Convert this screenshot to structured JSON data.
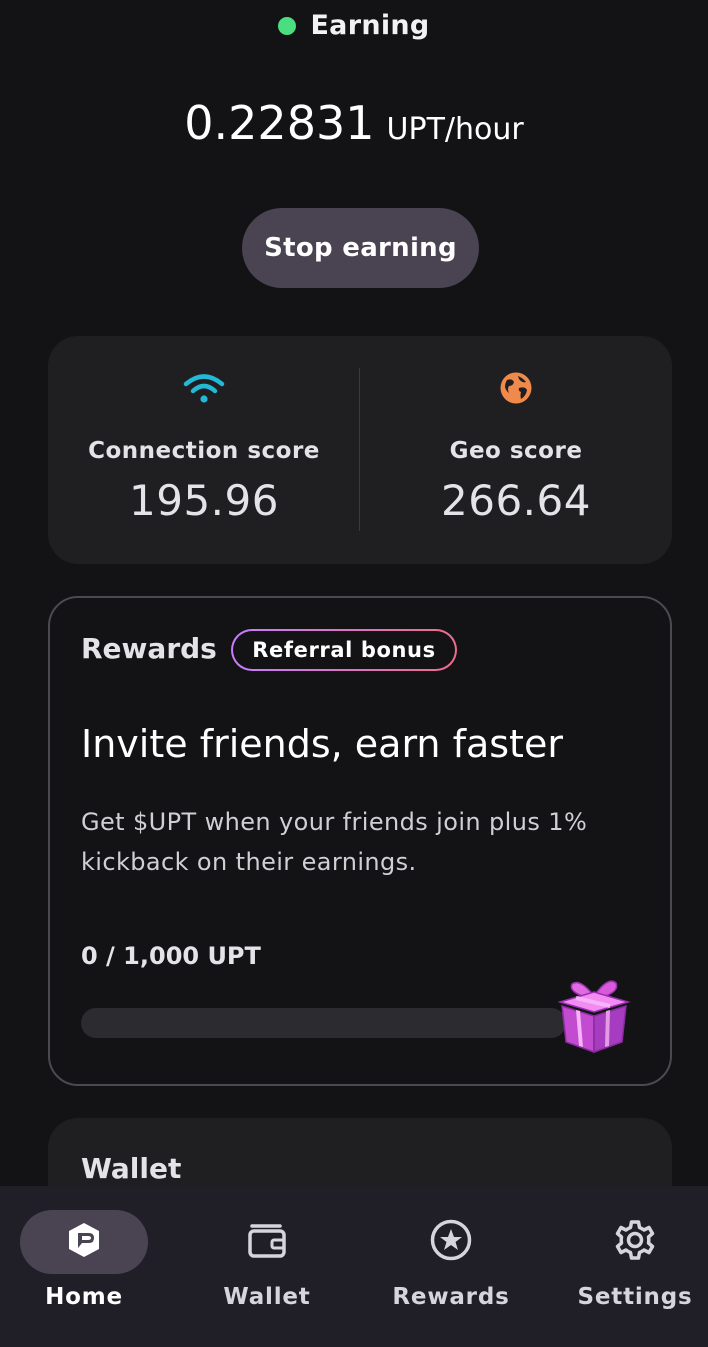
{
  "status": {
    "label": "Earning",
    "color": "#4ade80"
  },
  "earning": {
    "rate": "0.22831",
    "unit": "UPT/hour"
  },
  "actions": {
    "stop_label": "Stop earning"
  },
  "scores": {
    "connection": {
      "label": "Connection score",
      "value": "195.96",
      "icon": "wifi-icon",
      "color": "#22b8d6"
    },
    "geo": {
      "label": "Geo score",
      "value": "266.64",
      "icon": "globe-icon",
      "color": "#f08a4b"
    }
  },
  "rewards": {
    "title": "Rewards",
    "badge": "Referral bonus",
    "headline": "Invite friends, earn faster",
    "description": "Get $UPT when your friends join plus 1% kickback on their earnings.",
    "progress_label": "0 / 1,000 UPT",
    "progress_fraction": 0,
    "icon": "gift-icon"
  },
  "wallet": {
    "title": "Wallet"
  },
  "nav": {
    "items": [
      {
        "label": "Home",
        "icon": "home-icon",
        "active": true
      },
      {
        "label": "Wallet",
        "icon": "wallet-icon",
        "active": false
      },
      {
        "label": "Rewards",
        "icon": "star-icon",
        "active": false
      },
      {
        "label": "Settings",
        "icon": "gear-icon",
        "active": false
      }
    ]
  }
}
